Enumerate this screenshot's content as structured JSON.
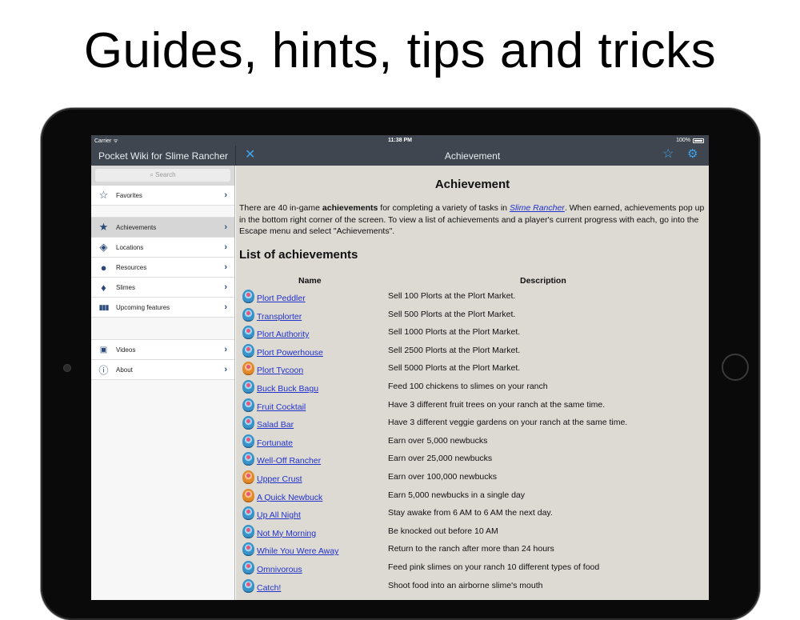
{
  "headline": "Guides, hints, tips and tricks",
  "status_bar": {
    "carrier": "Carrier ᯤ",
    "time": "11:38 PM",
    "battery": "100%"
  },
  "sidebar": {
    "title": "Pocket Wiki for Slime Rancher",
    "search_placeholder": "Search",
    "items": [
      {
        "label": "Favorites",
        "icon": "star-outline-icon"
      },
      {
        "label": "Achievements",
        "icon": "star-icon",
        "active": true
      },
      {
        "label": "Locations",
        "icon": "map-icon"
      },
      {
        "label": "Resources",
        "icon": "resource-icon"
      },
      {
        "label": "Slimes",
        "icon": "drop-icon"
      },
      {
        "label": "Upcoming features",
        "icon": "waveform-icon"
      },
      {
        "label": "Videos",
        "icon": "video-icon"
      },
      {
        "label": "About",
        "icon": "info-icon"
      }
    ]
  },
  "detail": {
    "nav_title": "Achievement",
    "title": "Achievement",
    "intro": {
      "p1": "There are 40 in-game ",
      "bold": "achievements",
      "p2": " for completing a variety of tasks in ",
      "link": "Slime Rancher",
      "p3": ". When earned, achievements pop up in the bottom right corner of the screen. To view a list of achievements and a player's current progress with each, go into the Escape menu and select \"Achievements\"."
    },
    "section_title": "List of achievements",
    "columns": [
      "Name",
      "Description"
    ],
    "rows": [
      {
        "name": "Plort Peddler",
        "desc": "Sell 100 Plorts at the Plort Market.",
        "badge": "blue"
      },
      {
        "name": "Transplorter",
        "desc": "Sell 500 Plorts at the Plort Market.",
        "badge": "blue"
      },
      {
        "name": "Plort Authority",
        "desc": "Sell 1000 Plorts at the Plort Market.",
        "badge": "blue"
      },
      {
        "name": "Plort Powerhouse",
        "desc": "Sell 2500 Plorts at the Plort Market.",
        "badge": "blue"
      },
      {
        "name": "Plort Tycoon",
        "desc": "Sell 5000 Plorts at the Plort Market.",
        "badge": "gold"
      },
      {
        "name": "Buck Buck Bagu",
        "desc": "Feed 100 chickens to slimes on your ranch",
        "badge": "blue"
      },
      {
        "name": "Fruit Cocktail",
        "desc": "Have 3 different fruit trees on your ranch at the same time.",
        "badge": "blue"
      },
      {
        "name": "Salad Bar",
        "desc": "Have 3 different veggie gardens on your ranch at the same time.",
        "badge": "blue"
      },
      {
        "name": "Fortunate",
        "desc": "Earn over 5,000 newbucks",
        "badge": "blue"
      },
      {
        "name": "Well-Off Rancher",
        "desc": "Earn over 25,000 newbucks",
        "badge": "blue"
      },
      {
        "name": "Upper Crust",
        "desc": "Earn over 100,000 newbucks",
        "badge": "gold"
      },
      {
        "name": "A Quick Newbuck",
        "desc": "Earn 5,000 newbucks in a single day",
        "badge": "gold"
      },
      {
        "name": "Up All Night",
        "desc": "Stay awake from 6 AM to 6 AM the next day.",
        "badge": "blue"
      },
      {
        "name": "Not My Morning",
        "desc": "Be knocked out before 10 AM",
        "badge": "blue"
      },
      {
        "name": "While You Were Away",
        "desc": "Return to the ranch after more than 24 hours",
        "badge": "blue"
      },
      {
        "name": "Omnivorous",
        "desc": "Feed pink slimes on your ranch 10 different types of food",
        "badge": "blue"
      },
      {
        "name": "Catch!",
        "desc": "Shoot food into an airborne slime's mouth",
        "badge": "blue"
      }
    ]
  }
}
